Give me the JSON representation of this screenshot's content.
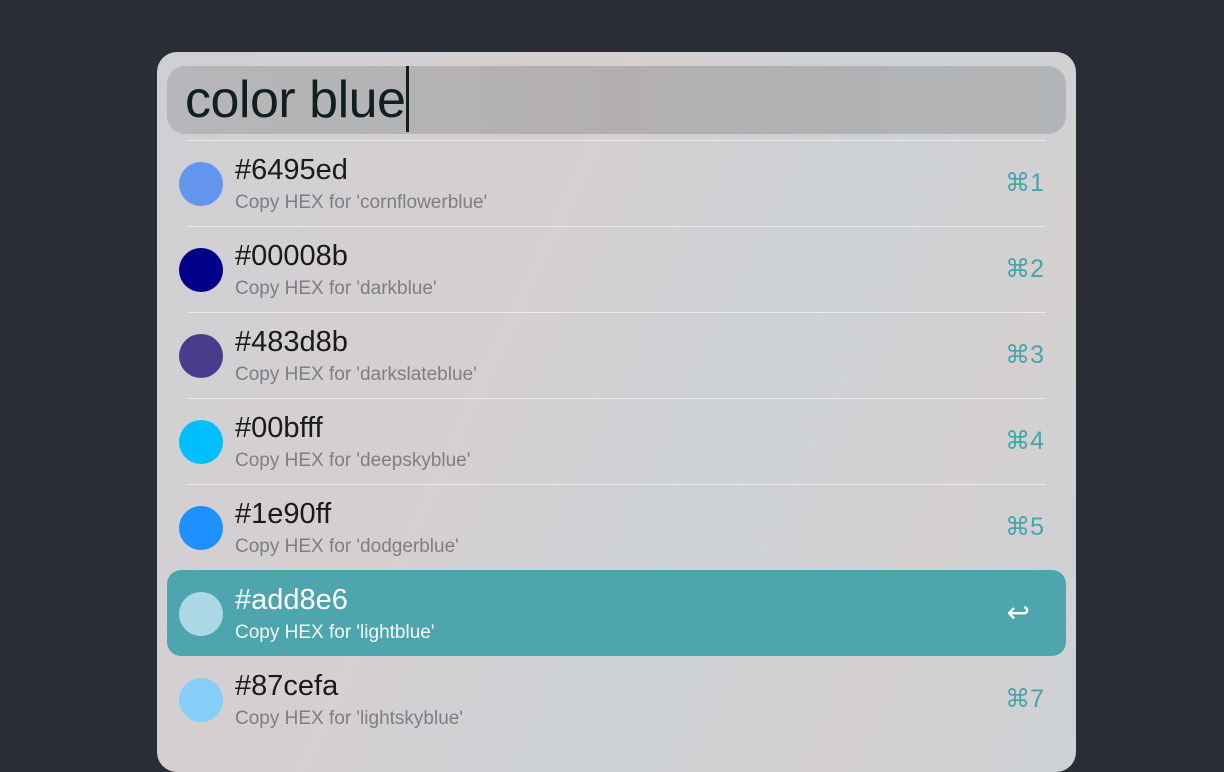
{
  "search": {
    "query": "color blue"
  },
  "results": [
    {
      "hex": "#6495ed",
      "subtitle": "Copy HEX for 'cornflowerblue'",
      "shortcut": "⌘1",
      "swatch_color": "#6495ed",
      "selected": false
    },
    {
      "hex": "#00008b",
      "subtitle": "Copy HEX for 'darkblue'",
      "shortcut": "⌘2",
      "swatch_color": "#00008b",
      "selected": false
    },
    {
      "hex": "#483d8b",
      "subtitle": "Copy HEX for 'darkslateblue'",
      "shortcut": "⌘3",
      "swatch_color": "#483d8b",
      "selected": false
    },
    {
      "hex": "#00bfff",
      "subtitle": "Copy HEX for 'deepskyblue'",
      "shortcut": "⌘4",
      "swatch_color": "#00bfff",
      "selected": false
    },
    {
      "hex": "#1e90ff",
      "subtitle": "Copy HEX for 'dodgerblue'",
      "shortcut": "⌘5",
      "swatch_color": "#1e90ff",
      "selected": false
    },
    {
      "hex": "#add8e6",
      "subtitle": "Copy HEX for 'lightblue'",
      "shortcut": "↩",
      "swatch_color": "#add8e6",
      "selected": true
    },
    {
      "hex": "#87cefa",
      "subtitle": "Copy HEX for 'lightskyblue'",
      "shortcut": "⌘7",
      "swatch_color": "#87cefa",
      "selected": false
    }
  ],
  "colors": {
    "background": "#2a2c36",
    "selection": "#4fa5ad",
    "shortcut_text": "#4aa3ab"
  }
}
